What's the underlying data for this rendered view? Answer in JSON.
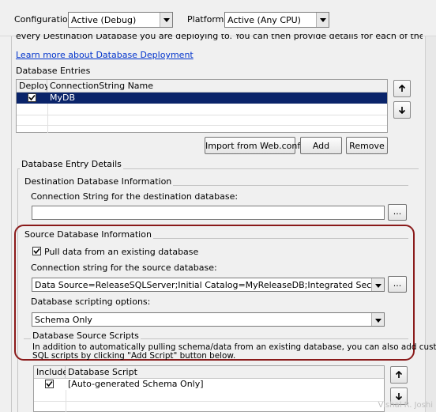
{
  "config": {
    "configuration_label": "Configuration:",
    "configuration_value": "Active (Debug)",
    "platform_label": "Platform:",
    "platform_value": "Active (Any CPU)"
  },
  "intro": {
    "cut_text": "every Destination Database you are deploying to. You can then provide details for each of these database entries.",
    "learn_more": "Learn more about Database Deployment"
  },
  "database_entries": {
    "title": "Database Entries",
    "col_deploy": "Deploy",
    "col_name": "ConnectionString Name",
    "rows": [
      {
        "checked": true,
        "name": "MyDB"
      }
    ],
    "buttons": {
      "import": "Import from Web.config",
      "add": "Add",
      "remove": "Remove"
    }
  },
  "details": {
    "title": "Database Entry Details",
    "destination": {
      "title": "Destination Database Information",
      "conn_label": "Connection String for the destination database:",
      "conn_value": "",
      "browse": "..."
    },
    "source": {
      "title": "Source Database Information",
      "pull_label": "Pull data from an existing database",
      "pull_checked": true,
      "conn_label": "Connection string for the source database:",
      "conn_value": "Data Source=ReleaseSQLServer;Initial Catalog=MyReleaseDB;Integrated Security=True",
      "browse": "...",
      "scripting_label": "Database scripting options:",
      "scripting_value": "Schema Only"
    },
    "scripts": {
      "title": "Database Source Scripts",
      "description_line1": "In addition to automatically pulling schema/data from an existing database, you can also add custom",
      "description_line2": "SQL scripts by clicking \"Add Script\" button below.",
      "col_include": "Include",
      "col_script": "Database Script",
      "rows": [
        {
          "checked": true,
          "script": "[Auto-generated Schema Only]"
        }
      ]
    }
  },
  "watermark": "Vishal R. Joshi"
}
